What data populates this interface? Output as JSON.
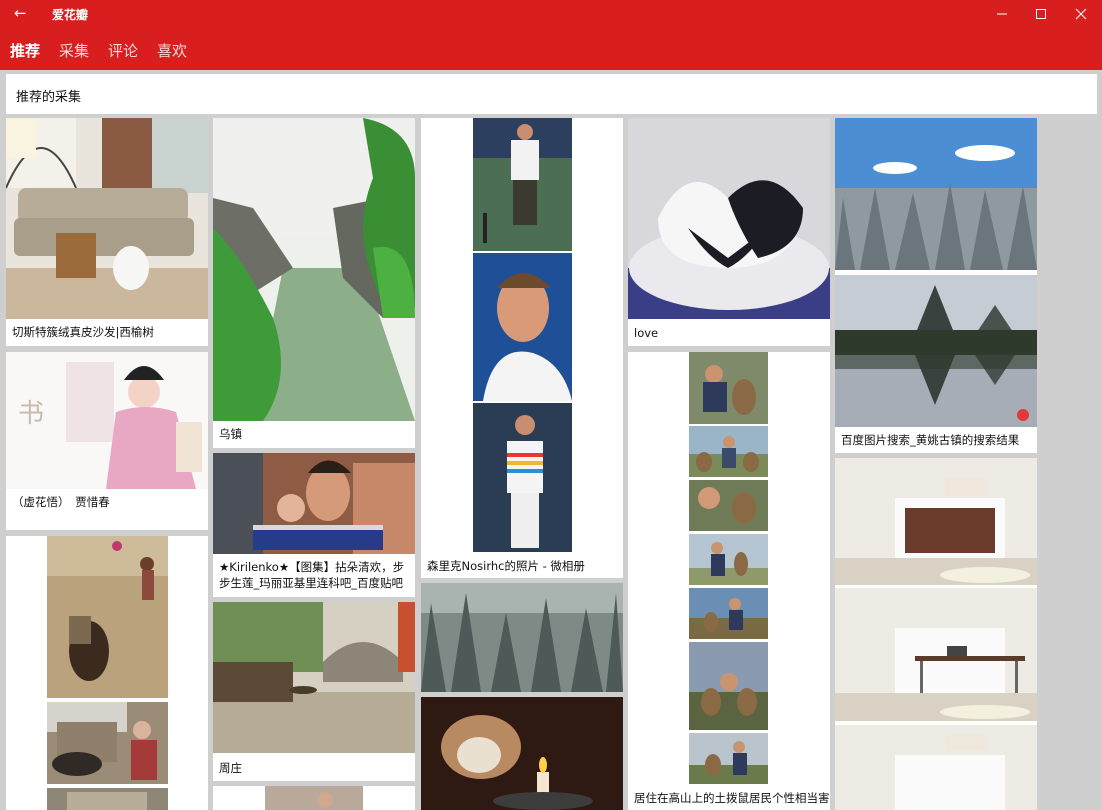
{
  "app": {
    "title": "爱花瓣"
  },
  "tabs": [
    {
      "label": "推荐"
    },
    {
      "label": "采集"
    },
    {
      "label": "评论"
    },
    {
      "label": "喜欢"
    }
  ],
  "section": {
    "title": "推荐的采集"
  },
  "pins": [
    {
      "caption": "切斯特簇绒真皮沙发|西榆树"
    },
    {
      "caption": "（虚花悟）　贾惜春"
    },
    {
      "caption": "乌镇"
    },
    {
      "caption": "★Kirilenko★【图集】拈朵清欢，步步生莲_玛丽亚基里连科吧_百度贴吧"
    },
    {
      "caption": "周庄"
    },
    {
      "caption": "森里克Nosirhc的照片 - 微相册"
    },
    {
      "caption": "love"
    },
    {
      "caption": "居住在高山上的土拨鼠居民个性相当害"
    },
    {
      "caption": "百度图片搜索_黄姚古镇的搜索结果"
    }
  ],
  "colors": {
    "accent": "#d81e1e",
    "background": "#cfcfcf"
  }
}
